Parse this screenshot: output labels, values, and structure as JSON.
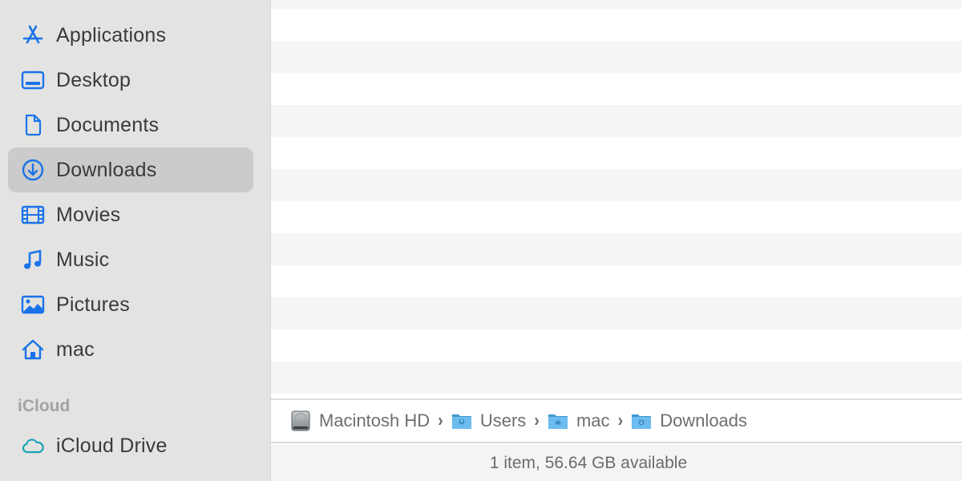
{
  "sidebar": {
    "favorites": [
      {
        "label": "Applications",
        "icon": "applications-icon"
      },
      {
        "label": "Desktop",
        "icon": "desktop-icon"
      },
      {
        "label": "Documents",
        "icon": "document-icon"
      },
      {
        "label": "Downloads",
        "icon": "downloads-icon",
        "selected": true
      },
      {
        "label": "Movies",
        "icon": "film-icon"
      },
      {
        "label": "Music",
        "icon": "music-note-icon"
      },
      {
        "label": "Pictures",
        "icon": "photo-icon"
      },
      {
        "label": "mac",
        "icon": "home-icon"
      }
    ],
    "icloud_header": "iCloud",
    "icloud": [
      {
        "label": "iCloud Drive",
        "icon": "cloud-icon"
      }
    ]
  },
  "pathbar": {
    "crumbs": [
      {
        "label": "Macintosh HD",
        "icon": "hard-drive-icon"
      },
      {
        "label": "Users",
        "icon": "users-folder-icon"
      },
      {
        "label": "mac",
        "icon": "home-folder-icon"
      },
      {
        "label": "Downloads",
        "icon": "downloads-folder-icon"
      }
    ],
    "separator": "›"
  },
  "status": {
    "text": "1 item, 56.64 GB available"
  },
  "colors": {
    "accent": "#1a73e8",
    "icloud": "#1aa3b8",
    "folder": "#5fb3e6"
  }
}
